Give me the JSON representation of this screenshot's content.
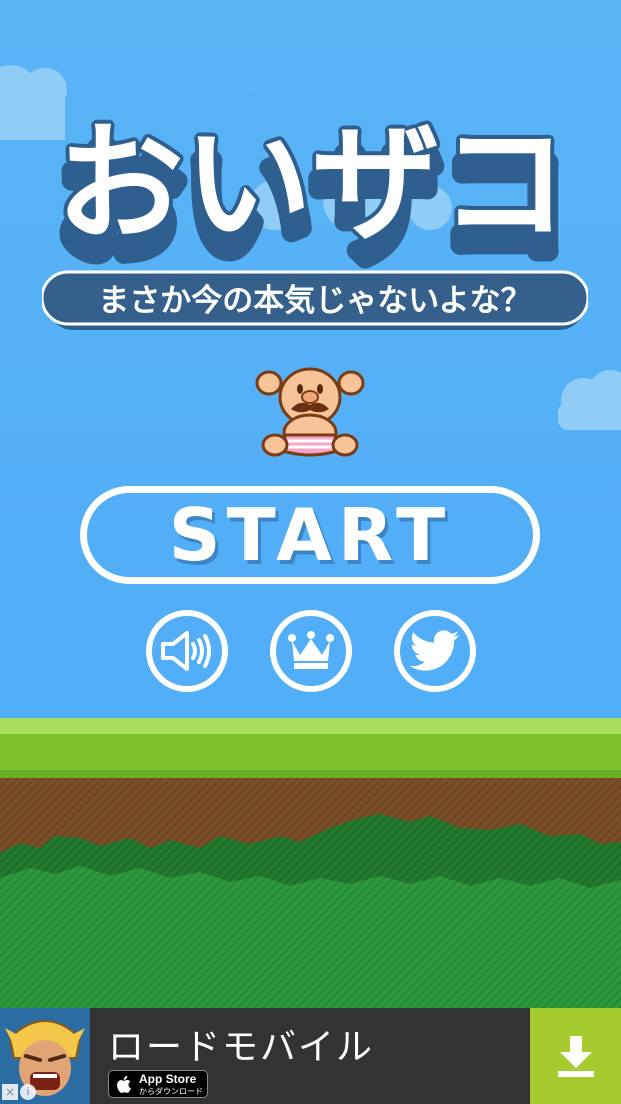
{
  "title": "おいザコ",
  "subtitle": "まさか今の本気じゃないよな？",
  "buttons": {
    "start_label": "START",
    "sound_icon": "speaker-icon",
    "ranking_icon": "crown-icon",
    "share_icon": "twitter-bird-icon"
  },
  "ad": {
    "title": "ロードモバイル",
    "store_name": "App Store",
    "store_sub": "からダウンロード",
    "download_icon": "download-arrow-icon",
    "close_label": "×",
    "info_label": "i"
  },
  "colors": {
    "sky": "#52aef7",
    "title_fill": "#ffffff",
    "title_shadow": "#2f5f8f",
    "subtitle_bg": "#35608c",
    "grass": "#7cc22c",
    "dirt": "#7a4f28",
    "bush": "#2e9a3c",
    "ad_bg": "#333333",
    "ad_download": "#a5cb2f"
  }
}
